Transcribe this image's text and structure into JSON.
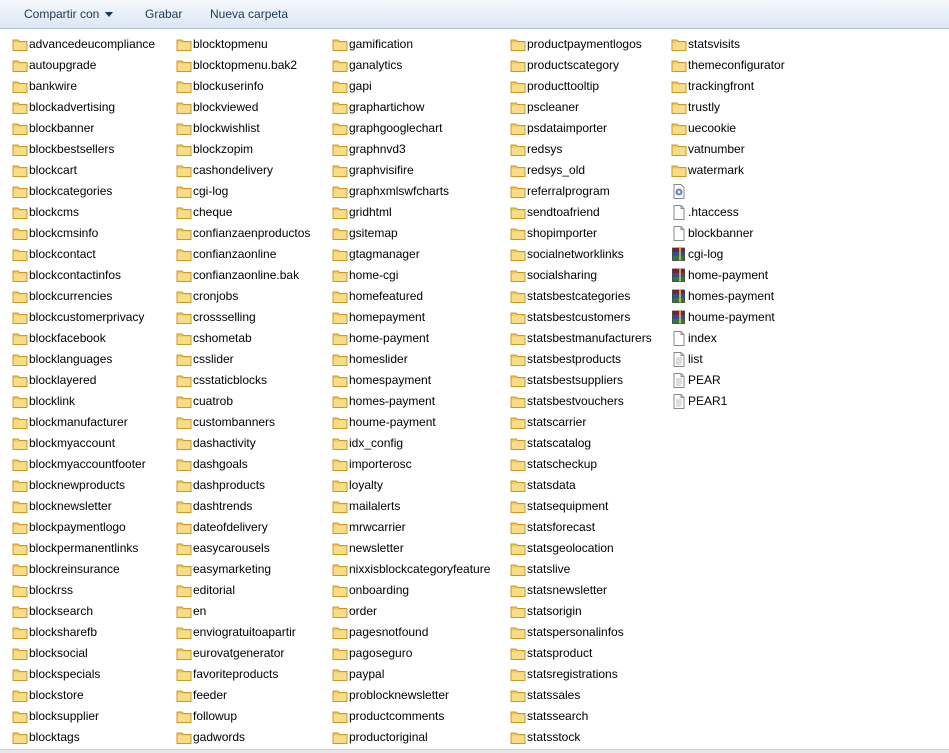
{
  "toolbar": {
    "share_label": "Compartir con",
    "burn_label": "Grabar",
    "new_folder_label": "Nueva carpeta"
  },
  "colors": {
    "folder": "#f0c85a",
    "folder_dark": "#c99a2a",
    "archive_red": "#8a1c2a",
    "archive_blue": "#2c4f9e",
    "archive_green": "#2f7a34",
    "file_border": "#8a8a8a"
  },
  "files": {
    "columns": [
      {
        "items": [
          {
            "label": "advancedeucompliance",
            "icon": "folder-icon"
          },
          {
            "label": "autoupgrade",
            "icon": "folder-icon"
          },
          {
            "label": "bankwire",
            "icon": "folder-icon"
          },
          {
            "label": "blockadvertising",
            "icon": "folder-icon"
          },
          {
            "label": "blockbanner",
            "icon": "folder-icon"
          },
          {
            "label": "blockbestsellers",
            "icon": "folder-icon"
          },
          {
            "label": "blockcart",
            "icon": "folder-icon"
          },
          {
            "label": "blockcategories",
            "icon": "folder-icon"
          },
          {
            "label": "blockcms",
            "icon": "folder-icon"
          },
          {
            "label": "blockcmsinfo",
            "icon": "folder-icon"
          },
          {
            "label": "blockcontact",
            "icon": "folder-icon"
          },
          {
            "label": "blockcontactinfos",
            "icon": "folder-icon"
          },
          {
            "label": "blockcurrencies",
            "icon": "folder-icon"
          },
          {
            "label": "blockcustomerprivacy",
            "icon": "folder-icon"
          },
          {
            "label": "blockfacebook",
            "icon": "folder-icon"
          },
          {
            "label": "blocklanguages",
            "icon": "folder-icon"
          },
          {
            "label": "blocklayered",
            "icon": "folder-icon"
          },
          {
            "label": "blocklink",
            "icon": "folder-icon"
          },
          {
            "label": "blockmanufacturer",
            "icon": "folder-icon"
          },
          {
            "label": "blockmyaccount",
            "icon": "folder-icon"
          },
          {
            "label": "blockmyaccountfooter",
            "icon": "folder-icon"
          },
          {
            "label": "blocknewproducts",
            "icon": "folder-icon"
          },
          {
            "label": "blocknewsletter",
            "icon": "folder-icon"
          },
          {
            "label": "blockpaymentlogo",
            "icon": "folder-icon"
          },
          {
            "label": "blockpermanentlinks",
            "icon": "folder-icon"
          },
          {
            "label": "blockreinsurance",
            "icon": "folder-icon"
          },
          {
            "label": "blockrss",
            "icon": "folder-icon"
          },
          {
            "label": "blocksearch",
            "icon": "folder-icon"
          },
          {
            "label": "blocksharefb",
            "icon": "folder-icon"
          },
          {
            "label": "blocksocial",
            "icon": "folder-icon"
          },
          {
            "label": "blockspecials",
            "icon": "folder-icon"
          },
          {
            "label": "blockstore",
            "icon": "folder-icon"
          },
          {
            "label": "blocksupplier",
            "icon": "folder-icon"
          },
          {
            "label": "blocktags",
            "icon": "folder-icon"
          }
        ]
      },
      {
        "items": [
          {
            "label": "blocktopmenu",
            "icon": "folder-icon"
          },
          {
            "label": "blocktopmenu.bak2",
            "icon": "folder-icon"
          },
          {
            "label": "blockuserinfo",
            "icon": "folder-icon"
          },
          {
            "label": "blockviewed",
            "icon": "folder-icon"
          },
          {
            "label": "blockwishlist",
            "icon": "folder-icon"
          },
          {
            "label": "blockzopim",
            "icon": "folder-icon"
          },
          {
            "label": "cashondelivery",
            "icon": "folder-icon"
          },
          {
            "label": "cgi-log",
            "icon": "folder-icon"
          },
          {
            "label": "cheque",
            "icon": "folder-icon"
          },
          {
            "label": "confianzaenproductos",
            "icon": "folder-icon"
          },
          {
            "label": "confianzaonline",
            "icon": "folder-icon"
          },
          {
            "label": "confianzaonline.bak",
            "icon": "folder-icon"
          },
          {
            "label": "cronjobs",
            "icon": "folder-icon"
          },
          {
            "label": "crossselling",
            "icon": "folder-icon"
          },
          {
            "label": "cshometab",
            "icon": "folder-icon"
          },
          {
            "label": "csslider",
            "icon": "folder-icon"
          },
          {
            "label": "csstaticblocks",
            "icon": "folder-icon"
          },
          {
            "label": "cuatrob",
            "icon": "folder-icon"
          },
          {
            "label": "custombanners",
            "icon": "folder-icon"
          },
          {
            "label": "dashactivity",
            "icon": "folder-icon"
          },
          {
            "label": "dashgoals",
            "icon": "folder-icon"
          },
          {
            "label": "dashproducts",
            "icon": "folder-icon"
          },
          {
            "label": "dashtrends",
            "icon": "folder-icon"
          },
          {
            "label": "dateofdelivery",
            "icon": "folder-icon"
          },
          {
            "label": "easycarousels",
            "icon": "folder-icon"
          },
          {
            "label": "easymarketing",
            "icon": "folder-icon"
          },
          {
            "label": "editorial",
            "icon": "folder-icon"
          },
          {
            "label": "en",
            "icon": "folder-icon"
          },
          {
            "label": "enviogratuitoapartir",
            "icon": "folder-icon"
          },
          {
            "label": "eurovatgenerator",
            "icon": "folder-icon"
          },
          {
            "label": "favoriteproducts",
            "icon": "folder-icon"
          },
          {
            "label": "feeder",
            "icon": "folder-icon"
          },
          {
            "label": "followup",
            "icon": "folder-icon"
          },
          {
            "label": "gadwords",
            "icon": "folder-icon"
          }
        ]
      },
      {
        "items": [
          {
            "label": "gamification",
            "icon": "folder-icon"
          },
          {
            "label": "ganalytics",
            "icon": "folder-icon"
          },
          {
            "label": "gapi",
            "icon": "folder-icon"
          },
          {
            "label": "graphartichow",
            "icon": "folder-icon"
          },
          {
            "label": "graphgooglechart",
            "icon": "folder-icon"
          },
          {
            "label": "graphnvd3",
            "icon": "folder-icon"
          },
          {
            "label": "graphvisifire",
            "icon": "folder-icon"
          },
          {
            "label": "graphxmlswfcharts",
            "icon": "folder-icon"
          },
          {
            "label": "gridhtml",
            "icon": "folder-icon"
          },
          {
            "label": "gsitemap",
            "icon": "folder-icon"
          },
          {
            "label": "gtagmanager",
            "icon": "folder-icon"
          },
          {
            "label": "home-cgi",
            "icon": "folder-icon"
          },
          {
            "label": "homefeatured",
            "icon": "folder-icon"
          },
          {
            "label": "homepayment",
            "icon": "folder-icon"
          },
          {
            "label": "home-payment",
            "icon": "folder-icon"
          },
          {
            "label": "homeslider",
            "icon": "folder-icon"
          },
          {
            "label": "homespayment",
            "icon": "folder-icon"
          },
          {
            "label": "homes-payment",
            "icon": "folder-icon"
          },
          {
            "label": "houme-payment",
            "icon": "folder-icon"
          },
          {
            "label": "idx_config",
            "icon": "folder-icon"
          },
          {
            "label": "importerosc",
            "icon": "folder-icon"
          },
          {
            "label": "loyalty",
            "icon": "folder-icon"
          },
          {
            "label": "mailalerts",
            "icon": "folder-icon"
          },
          {
            "label": "mrwcarrier",
            "icon": "folder-icon"
          },
          {
            "label": "newsletter",
            "icon": "folder-icon"
          },
          {
            "label": "nixxisblockcategoryfeature",
            "icon": "folder-icon"
          },
          {
            "label": "onboarding",
            "icon": "folder-icon"
          },
          {
            "label": "order",
            "icon": "folder-icon"
          },
          {
            "label": "pagesnotfound",
            "icon": "folder-icon"
          },
          {
            "label": "pagoseguro",
            "icon": "folder-icon"
          },
          {
            "label": "paypal",
            "icon": "folder-icon"
          },
          {
            "label": "problocknewsletter",
            "icon": "folder-icon"
          },
          {
            "label": "productcomments",
            "icon": "folder-icon"
          },
          {
            "label": "productoriginal",
            "icon": "folder-icon"
          }
        ]
      },
      {
        "items": [
          {
            "label": "productpaymentlogos",
            "icon": "folder-icon"
          },
          {
            "label": "productscategory",
            "icon": "folder-icon"
          },
          {
            "label": "producttooltip",
            "icon": "folder-icon"
          },
          {
            "label": "pscleaner",
            "icon": "folder-icon"
          },
          {
            "label": "psdataimporter",
            "icon": "folder-icon"
          },
          {
            "label": "redsys",
            "icon": "folder-icon"
          },
          {
            "label": "redsys_old",
            "icon": "folder-icon"
          },
          {
            "label": "referralprogram",
            "icon": "folder-icon"
          },
          {
            "label": "sendtoafriend",
            "icon": "folder-icon"
          },
          {
            "label": "shopimporter",
            "icon": "folder-icon"
          },
          {
            "label": "socialnetworklinks",
            "icon": "folder-icon"
          },
          {
            "label": "socialsharing",
            "icon": "folder-icon"
          },
          {
            "label": "statsbestcategories",
            "icon": "folder-icon"
          },
          {
            "label": "statsbestcustomers",
            "icon": "folder-icon"
          },
          {
            "label": "statsbestmanufacturers",
            "icon": "folder-icon"
          },
          {
            "label": "statsbestproducts",
            "icon": "folder-icon"
          },
          {
            "label": "statsbestsuppliers",
            "icon": "folder-icon"
          },
          {
            "label": "statsbestvouchers",
            "icon": "folder-icon"
          },
          {
            "label": "statscarrier",
            "icon": "folder-icon"
          },
          {
            "label": "statscatalog",
            "icon": "folder-icon"
          },
          {
            "label": "statscheckup",
            "icon": "folder-icon"
          },
          {
            "label": "statsdata",
            "icon": "folder-icon"
          },
          {
            "label": "statsequipment",
            "icon": "folder-icon"
          },
          {
            "label": "statsforecast",
            "icon": "folder-icon"
          },
          {
            "label": "statsgeolocation",
            "icon": "folder-icon"
          },
          {
            "label": "statslive",
            "icon": "folder-icon"
          },
          {
            "label": "statsnewsletter",
            "icon": "folder-icon"
          },
          {
            "label": "statsorigin",
            "icon": "folder-icon"
          },
          {
            "label": "statspersonalinfos",
            "icon": "folder-icon"
          },
          {
            "label": "statsproduct",
            "icon": "folder-icon"
          },
          {
            "label": "statsregistrations",
            "icon": "folder-icon"
          },
          {
            "label": "statssales",
            "icon": "folder-icon"
          },
          {
            "label": "statssearch",
            "icon": "folder-icon"
          },
          {
            "label": "statsstock",
            "icon": "folder-icon"
          }
        ]
      },
      {
        "items": [
          {
            "label": "statsvisits",
            "icon": "folder-icon"
          },
          {
            "label": "themeconfigurator",
            "icon": "folder-icon"
          },
          {
            "label": "trackingfront",
            "icon": "folder-icon"
          },
          {
            "label": "trustly",
            "icon": "folder-icon"
          },
          {
            "label": "uecookie",
            "icon": "folder-icon"
          },
          {
            "label": "vatnumber",
            "icon": "folder-icon"
          },
          {
            "label": "watermark",
            "icon": "folder-icon"
          },
          {
            "label": "",
            "icon": "settings-file-icon"
          },
          {
            "label": ".htaccess",
            "icon": "file-icon"
          },
          {
            "label": "blockbanner",
            "icon": "file-icon"
          },
          {
            "label": "cgi-log",
            "icon": "archive-icon"
          },
          {
            "label": "home-payment",
            "icon": "archive-icon"
          },
          {
            "label": "homes-payment",
            "icon": "archive-icon"
          },
          {
            "label": "houme-payment",
            "icon": "archive-icon"
          },
          {
            "label": "index",
            "icon": "file-icon"
          },
          {
            "label": "list",
            "icon": "text-file-icon"
          },
          {
            "label": "PEAR",
            "icon": "text-file-icon"
          },
          {
            "label": "PEAR1",
            "icon": "text-file-icon"
          }
        ]
      }
    ]
  }
}
